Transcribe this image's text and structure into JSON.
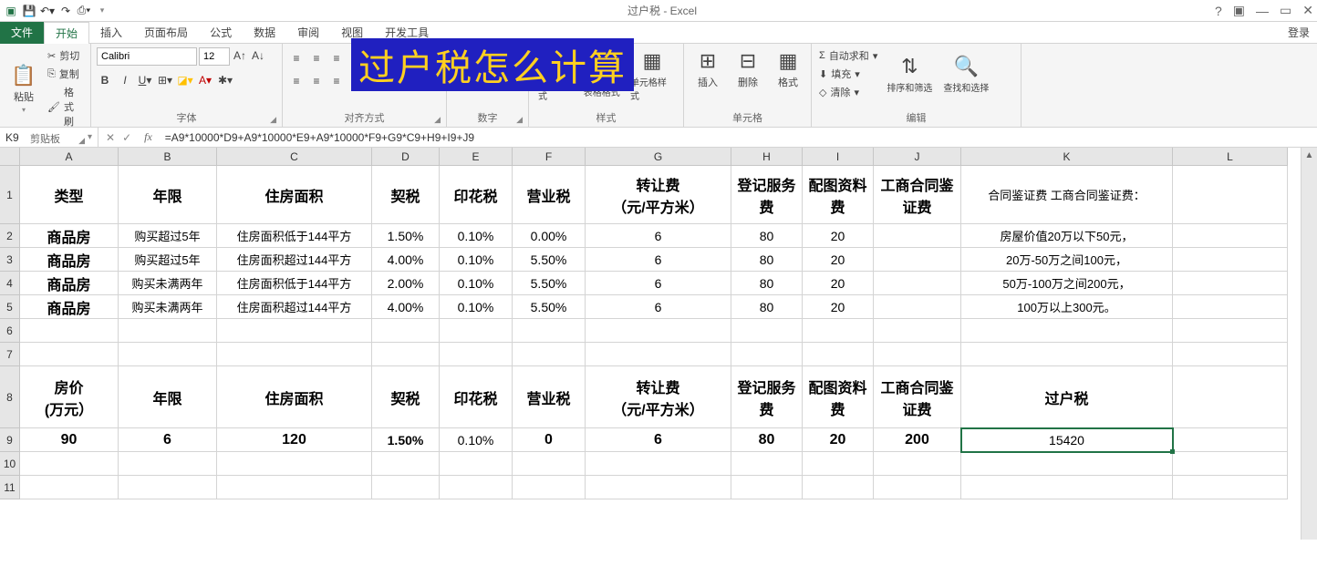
{
  "window": {
    "title": "过户税 - Excel",
    "sign_in": "登录"
  },
  "qat": {
    "save": "保存",
    "undo": "撤消",
    "redo": "恢复"
  },
  "tabs": {
    "file": "文件",
    "home": "开始",
    "insert": "插入",
    "page_layout": "页面布局",
    "formulas": "公式",
    "data": "数据",
    "review": "审阅",
    "view": "视图",
    "dev": "开发工具"
  },
  "ribbon": {
    "clipboard": {
      "label": "剪贴板",
      "paste": "粘贴",
      "cut": "剪切",
      "copy": "复制",
      "painter": "格式刷"
    },
    "font": {
      "label": "字体",
      "name": "Calibri",
      "size": "12"
    },
    "alignment": {
      "label": "对齐方式"
    },
    "number": {
      "label": "数字"
    },
    "styles": {
      "label": "样式",
      "cond_fmt": "条件格式",
      "table_fmt": "套用\n表格格式",
      "cell_style": "单元格样式"
    },
    "cells": {
      "label": "单元格",
      "insert": "插入",
      "delete": "删除",
      "format": "格式"
    },
    "editing": {
      "label": "编辑",
      "autosum": "自动求和",
      "fill": "填充",
      "clear": "清除",
      "sort": "排序和筛选",
      "find": "查找和选择"
    }
  },
  "overlay": "过户税怎么计算",
  "name_box": "K9",
  "formula": "=A9*10000*D9+A9*10000*E9+A9*10000*F9+G9*C9+H9+I9+J9",
  "columns": [
    "A",
    "B",
    "C",
    "D",
    "E",
    "F",
    "G",
    "H",
    "I",
    "J",
    "K",
    "L"
  ],
  "rows": [
    {
      "num": "1",
      "h": "row-h0",
      "cells": [
        "类型",
        "年限",
        "住房面积",
        "契税",
        "印花税",
        "营业税",
        "转让费\n（元/平方米）",
        "登记服务费",
        "配图资料费",
        "工商合同鉴证费",
        "合同鉴证费 工商合同鉴证费：",
        ""
      ],
      "cls": [
        "hdr",
        "hdr",
        "hdr",
        "hdr",
        "hdr",
        "hdr",
        "hdr",
        "hdr",
        "hdr",
        "hdr",
        "sm",
        ""
      ]
    },
    {
      "num": "2",
      "h": "row-h1",
      "cells": [
        "商品房",
        "购买超过5年",
        "住房面积低于144平方",
        "1.50%",
        "0.10%",
        "0.00%",
        "6",
        "80",
        "20",
        "",
        "房屋价值20万以下50元，",
        ""
      ],
      "cls": [
        "hdr",
        "sm",
        "sm",
        "",
        "",
        "",
        "",
        "",
        "",
        "",
        "sm",
        ""
      ]
    },
    {
      "num": "3",
      "h": "row-h1",
      "cells": [
        "商品房",
        "购买超过5年",
        "住房面积超过144平方",
        "4.00%",
        "0.10%",
        "5.50%",
        "6",
        "80",
        "20",
        "",
        "20万-50万之间100元，",
        ""
      ],
      "cls": [
        "hdr",
        "sm",
        "sm",
        "",
        "",
        "",
        "",
        "",
        "",
        "",
        "sm",
        ""
      ]
    },
    {
      "num": "4",
      "h": "row-h1",
      "cells": [
        "商品房",
        "购买未满两年",
        "住房面积低于144平方",
        "2.00%",
        "0.10%",
        "5.50%",
        "6",
        "80",
        "20",
        "",
        "50万-100万之间200元，",
        ""
      ],
      "cls": [
        "hdr",
        "sm",
        "sm",
        "",
        "",
        "",
        "",
        "",
        "",
        "",
        "sm",
        ""
      ]
    },
    {
      "num": "5",
      "h": "row-h1",
      "cells": [
        "商品房",
        "购买未满两年",
        "住房面积超过144平方",
        "4.00%",
        "0.10%",
        "5.50%",
        "6",
        "80",
        "20",
        "",
        "100万以上300元。",
        ""
      ],
      "cls": [
        "hdr",
        "sm",
        "sm",
        "",
        "",
        "",
        "",
        "",
        "",
        "",
        "sm",
        ""
      ]
    },
    {
      "num": "6",
      "h": "row-h1",
      "cells": [
        "",
        "",
        "",
        "",
        "",
        "",
        "",
        "",
        "",
        "",
        "",
        ""
      ],
      "cls": [
        "",
        "",
        "",
        "",
        "",
        "",
        "",
        "",
        "",
        "",
        "",
        ""
      ]
    },
    {
      "num": "7",
      "h": "row-h1",
      "cells": [
        "",
        "",
        "",
        "",
        "",
        "",
        "",
        "",
        "",
        "",
        "",
        ""
      ],
      "cls": [
        "",
        "",
        "",
        "",
        "",
        "",
        "",
        "",
        "",
        "",
        "",
        ""
      ]
    },
    {
      "num": "8",
      "h": "row-h2",
      "cells": [
        "房价\n(万元）",
        "年限",
        "住房面积",
        "契税",
        "印花税",
        "营业税",
        "转让费\n（元/平方米）",
        "登记服务费",
        "配图资料费",
        "工商合同鉴证费",
        "过户税",
        ""
      ],
      "cls": [
        "hdr",
        "hdr",
        "hdr",
        "hdr",
        "hdr",
        "hdr",
        "hdr",
        "hdr",
        "hdr",
        "hdr",
        "hdr",
        ""
      ]
    },
    {
      "num": "9",
      "h": "row-h1",
      "cells": [
        "90",
        "6",
        "120",
        "1.50%",
        "0.10%",
        "0",
        "6",
        "80",
        "20",
        "200",
        "15420",
        ""
      ],
      "cls": [
        "hdr",
        "hdr",
        "hdr",
        "bold",
        "",
        "hdr",
        "hdr",
        "hdr",
        "hdr",
        "hdr",
        "",
        ""
      ]
    },
    {
      "num": "10",
      "h": "row-h1",
      "cells": [
        "",
        "",
        "",
        "",
        "",
        "",
        "",
        "",
        "",
        "",
        "",
        ""
      ],
      "cls": [
        "",
        "",
        "",
        "",
        "",
        "",
        "",
        "",
        "",
        "",
        "",
        ""
      ]
    },
    {
      "num": "11",
      "h": "row-h1",
      "cells": [
        "",
        "",
        "",
        "",
        "",
        "",
        "",
        "",
        "",
        "",
        "",
        ""
      ],
      "cls": [
        "",
        "",
        "",
        "",
        "",
        "",
        "",
        "",
        "",
        "",
        "",
        ""
      ]
    }
  ],
  "selected": {
    "row": 8,
    "col": 10
  }
}
